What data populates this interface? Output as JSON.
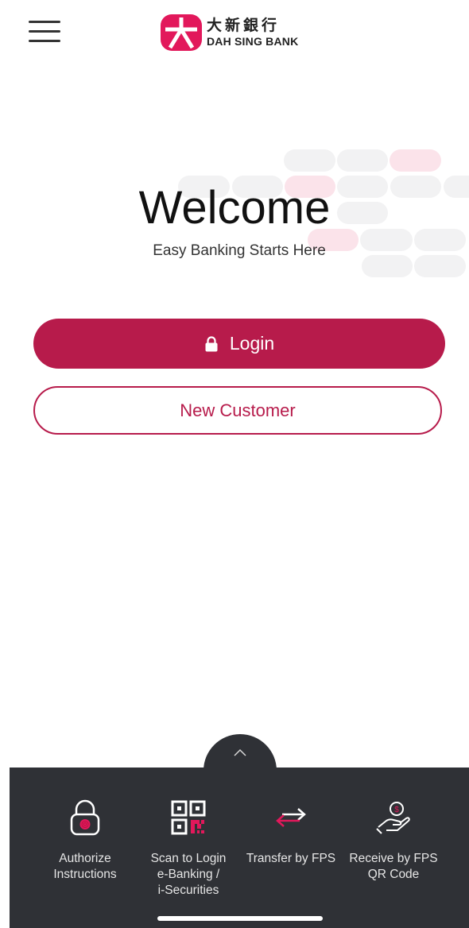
{
  "header": {
    "menu_icon": "hamburger-menu-icon",
    "logo": {
      "chinese_name": "大新銀行",
      "english_name": "DAH SING BANK",
      "brand_color": "#e2185b"
    }
  },
  "main": {
    "title": "Welcome",
    "subtitle": "Easy Banking Starts Here",
    "login_button": {
      "label": "Login",
      "icon": "lock-icon"
    },
    "new_customer_button": {
      "label": "New Customer"
    }
  },
  "quick_actions": {
    "toggle_icon": "chevron-up-icon",
    "items": [
      {
        "label": "Authorize\nInstructions",
        "icon": "padlock-fingerprint-icon"
      },
      {
        "label": "Scan to Login\ne-Banking /\ni-Securities",
        "icon": "qr-code-icon"
      },
      {
        "label": "Transfer by FPS",
        "icon": "transfer-arrows-icon"
      },
      {
        "label": "Receive by FPS\nQR Code",
        "icon": "hand-coin-icon"
      }
    ]
  },
  "colors": {
    "accent": "#b71b4b",
    "panel": "#2f3136",
    "pink_icon": "#e2185b"
  }
}
